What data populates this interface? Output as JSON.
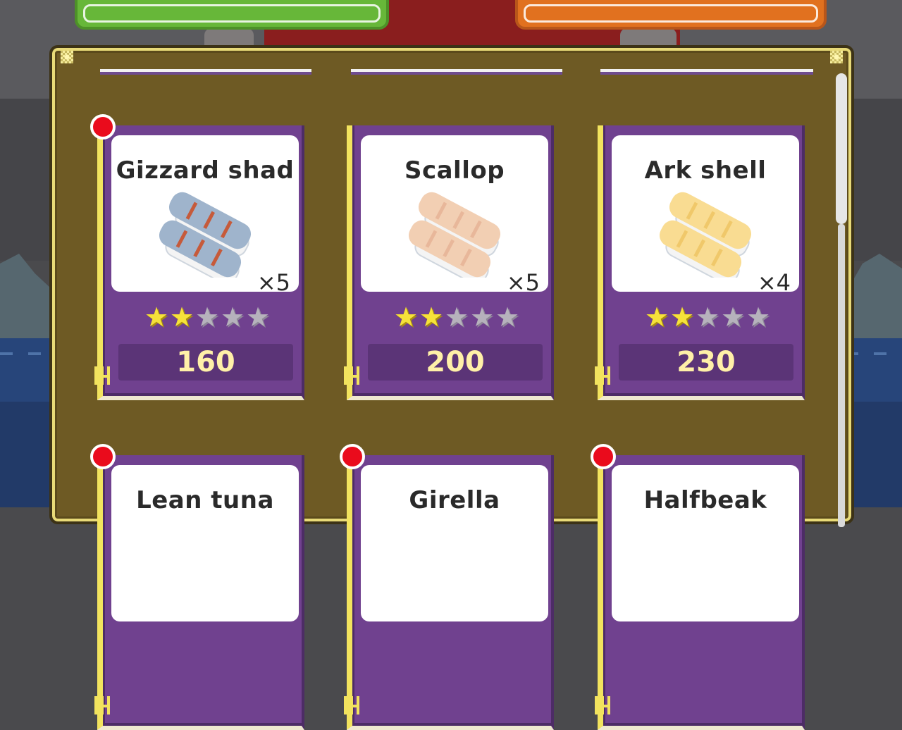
{
  "cards": [
    {
      "name": "Gizzard shad",
      "quantity": "×5",
      "stars_filled": 2,
      "stars_total": 5,
      "price": "160",
      "is_new": true,
      "sushi_color": "#9fb4cc",
      "sushi_accent": "#c65a3a"
    },
    {
      "name": "Scallop",
      "quantity": "×5",
      "stars_filled": 2,
      "stars_total": 5,
      "price": "200",
      "is_new": false,
      "sushi_color": "#f2cfb3",
      "sushi_accent": "#e8b79a"
    },
    {
      "name": "Ark shell",
      "quantity": "×4",
      "stars_filled": 2,
      "stars_total": 5,
      "price": "230",
      "is_new": false,
      "sushi_color": "#f9dc92",
      "sushi_accent": "#f0c86a"
    },
    {
      "name": "Lean tuna",
      "is_new": true
    },
    {
      "name": "Girella",
      "is_new": true
    },
    {
      "name": "Halfbeak",
      "is_new": true
    }
  ],
  "colors": {
    "panel_brown": "#6e5a24",
    "card_purple": "#70418f",
    "star_on": "#f6e23a",
    "star_off": "#b6b2bc",
    "new_dot": "#ea0b1c",
    "price_text": "#fff0a8",
    "top_button_left": "#67b739",
    "top_button_right": "#e1711f"
  },
  "icons": {
    "star": "star-icon",
    "new_marker": "new-dot-icon",
    "fork": "fork-icon"
  }
}
